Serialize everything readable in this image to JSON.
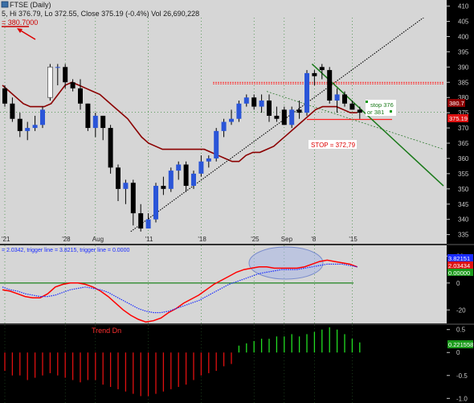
{
  "window": {
    "title": "FTSE (Daily)",
    "ohlc_text": "5, Hi 376.79, Lo 372.55, Close 375.19 (-0.4%) Vol 26,690,228",
    "ref_price_text": "= 380.7000"
  },
  "colors": {
    "up": "#2a55d8",
    "down": "#000000",
    "ma": "#8b0000",
    "resistance": "#ff2020",
    "trendline_up": "#000000",
    "trendline_down": "#1a7a1a",
    "macd": "#ff0000",
    "signal": "#1a2cff",
    "zero_line": "#2e8b2e",
    "hist_neg": "#e01010",
    "hist_pos": "#22dd22",
    "panel_bg": "#d6d6d6"
  },
  "price_panel": {
    "ylim": [
      332,
      412
    ],
    "y_ticks": [
      335,
      340,
      345,
      350,
      355,
      360,
      365,
      370,
      375,
      380,
      385,
      390,
      395,
      400,
      405,
      410
    ],
    "x_labels": [
      "'21",
      "'28",
      "Aug",
      "'11",
      "'18",
      "'25",
      "Sep",
      "'8",
      "'15"
    ],
    "annotations": {
      "stop_box": "STOP = 372,79",
      "stop_note_1": "stop  376",
      "stop_note_2": "or 381",
      "last_price_label": "380.7",
      "close_label": "375.19"
    }
  },
  "macd_panel": {
    "legend_text": "= 2.0342, trigger line = 3.8215, trigger line = 0.0000",
    "y_ticks": [
      20,
      0,
      -20
    ],
    "labels": {
      "macd_value": "3.82151",
      "signal_value": "2.03434",
      "zero_value": "0.00000"
    }
  },
  "trend_panel": {
    "title": "Trend Dn",
    "y_ticks": [
      "0.5",
      "0",
      "-0.5",
      "-1.0"
    ],
    "value_label": "0.221558"
  },
  "chart_data": [
    {
      "type": "candlestick",
      "title": "FTSE (Daily)",
      "ylim": [
        332,
        412
      ],
      "candles": [
        {
          "o": 383,
          "h": 384,
          "l": 377,
          "c": 378
        },
        {
          "o": 378,
          "h": 380,
          "l": 372,
          "c": 373
        },
        {
          "o": 373,
          "h": 375,
          "l": 367,
          "c": 369
        },
        {
          "o": 369,
          "h": 372,
          "l": 366,
          "c": 370
        },
        {
          "o": 370,
          "h": 374,
          "l": 369,
          "c": 371
        },
        {
          "o": 371,
          "h": 377,
          "l": 370,
          "c": 376
        },
        {
          "o": 380,
          "h": 391,
          "l": 379,
          "c": 390
        },
        {
          "o": 390,
          "h": 391,
          "l": 384,
          "c": 390
        },
        {
          "o": 390,
          "h": 391,
          "l": 383,
          "c": 385
        },
        {
          "o": 385,
          "h": 386,
          "l": 382,
          "c": 383
        },
        {
          "o": 383,
          "h": 386,
          "l": 376,
          "c": 378
        },
        {
          "o": 378,
          "h": 378,
          "l": 369,
          "c": 370
        },
        {
          "o": 370,
          "h": 375,
          "l": 367,
          "c": 374
        },
        {
          "o": 374,
          "h": 374,
          "l": 366,
          "c": 370
        },
        {
          "o": 370,
          "h": 371,
          "l": 355,
          "c": 357
        },
        {
          "o": 357,
          "h": 358,
          "l": 346,
          "c": 350
        },
        {
          "o": 350,
          "h": 353,
          "l": 345,
          "c": 352
        },
        {
          "o": 352,
          "h": 353,
          "l": 338,
          "c": 342
        },
        {
          "o": 342,
          "h": 345,
          "l": 336,
          "c": 337
        },
        {
          "o": 337,
          "h": 342,
          "l": 337,
          "c": 340
        },
        {
          "o": 340,
          "h": 352,
          "l": 339,
          "c": 351
        },
        {
          "o": 351,
          "h": 354,
          "l": 348,
          "c": 350
        },
        {
          "o": 350,
          "h": 357,
          "l": 349,
          "c": 356
        },
        {
          "o": 356,
          "h": 359,
          "l": 353,
          "c": 358
        },
        {
          "o": 358,
          "h": 359,
          "l": 349,
          "c": 351
        },
        {
          "o": 351,
          "h": 356,
          "l": 350,
          "c": 355
        },
        {
          "o": 355,
          "h": 361,
          "l": 354,
          "c": 359
        },
        {
          "o": 359,
          "h": 361,
          "l": 357,
          "c": 360
        },
        {
          "o": 360,
          "h": 370,
          "l": 359,
          "c": 369
        },
        {
          "o": 369,
          "h": 373,
          "l": 367,
          "c": 372
        },
        {
          "o": 372,
          "h": 376,
          "l": 371,
          "c": 373
        },
        {
          "o": 373,
          "h": 379,
          "l": 372,
          "c": 378
        },
        {
          "o": 378,
          "h": 381,
          "l": 377,
          "c": 380
        },
        {
          "o": 380,
          "h": 381,
          "l": 376,
          "c": 377
        },
        {
          "o": 377,
          "h": 381,
          "l": 375,
          "c": 379
        },
        {
          "o": 379,
          "h": 381,
          "l": 372,
          "c": 374
        },
        {
          "o": 374,
          "h": 377,
          "l": 372,
          "c": 373
        },
        {
          "o": 376,
          "h": 377,
          "l": 371,
          "c": 371
        },
        {
          "o": 371,
          "h": 377,
          "l": 370,
          "c": 376
        },
        {
          "o": 376,
          "h": 379,
          "l": 373,
          "c": 375
        },
        {
          "o": 375,
          "h": 389,
          "l": 374,
          "c": 388
        },
        {
          "o": 388,
          "h": 389,
          "l": 384,
          "c": 387
        },
        {
          "o": 390,
          "h": 391,
          "l": 386,
          "c": 389
        },
        {
          "o": 389,
          "h": 390,
          "l": 378,
          "c": 379
        },
        {
          "o": 379,
          "h": 383,
          "l": 375,
          "c": 381
        },
        {
          "o": 381,
          "h": 382,
          "l": 377,
          "c": 378
        },
        {
          "o": 378,
          "h": 379,
          "l": 376,
          "c": 376
        },
        {
          "o": 376,
          "h": 377,
          "l": 373,
          "c": 375
        }
      ],
      "moving_average": [
        384,
        382,
        380,
        378,
        377,
        377,
        377,
        378,
        381,
        384,
        385,
        384,
        383,
        382,
        381,
        379,
        377,
        375,
        373,
        370,
        367,
        365,
        364,
        363,
        363,
        363,
        363,
        363,
        363,
        363,
        362,
        361,
        360,
        359,
        359,
        361,
        362,
        362,
        363,
        364,
        366,
        368,
        370,
        372,
        374,
        376,
        377,
        377,
        377,
        376,
        375,
        375
      ],
      "resistance_levels": [
        385,
        384.5
      ],
      "stop_level": 372.79,
      "last_price": 380.7,
      "close": 375.19
    },
    {
      "type": "line",
      "title": "MACD",
      "ylim": [
        -30,
        28
      ],
      "series": [
        {
          "name": "trigger line",
          "values": [
            -5,
            -6,
            -8,
            -10,
            -11,
            -11,
            -8,
            -3,
            -1,
            0,
            0,
            -1,
            -3,
            -6,
            -10,
            -15,
            -20,
            -24,
            -27,
            -29,
            -28,
            -26,
            -22,
            -19,
            -15,
            -12,
            -9,
            -5,
            -1,
            2,
            5,
            8,
            10,
            11,
            12,
            12,
            11,
            11,
            11,
            11,
            12,
            14,
            16,
            17,
            16,
            15,
            14,
            12
          ]
        },
        {
          "name": "trigger line",
          "values": [
            -3,
            -5,
            -6,
            -8,
            -9,
            -10,
            -10,
            -9,
            -7,
            -5,
            -4,
            -3,
            -4,
            -5,
            -7,
            -10,
            -13,
            -16,
            -19,
            -21,
            -22,
            -22,
            -21,
            -19,
            -17,
            -15,
            -13,
            -10,
            -7,
            -4,
            -1,
            1,
            3,
            5,
            7,
            8,
            9,
            10,
            10,
            10,
            11,
            12,
            13,
            14,
            14,
            14,
            13,
            12
          ]
        }
      ]
    },
    {
      "type": "bar",
      "title": "Trend Dn",
      "ylim": [
        -1.1,
        0.6
      ],
      "values": [
        -0.4,
        -0.5,
        -0.5,
        -0.6,
        -0.55,
        -0.5,
        -0.45,
        -0.5,
        -0.55,
        -0.6,
        -0.65,
        -0.6,
        -0.6,
        -0.7,
        -0.75,
        -0.8,
        -0.85,
        -0.9,
        -0.95,
        -0.95,
        -0.9,
        -0.85,
        -0.8,
        -0.75,
        -0.7,
        -0.6,
        -0.5,
        -0.45,
        -0.4,
        -0.3,
        -0.25,
        0.15,
        0.2,
        0.25,
        0.3,
        0.3,
        0.35,
        0.35,
        0.4,
        0.35,
        0.4,
        0.45,
        0.5,
        0.55,
        0.5,
        0.4,
        0.3,
        0.22
      ]
    }
  ]
}
